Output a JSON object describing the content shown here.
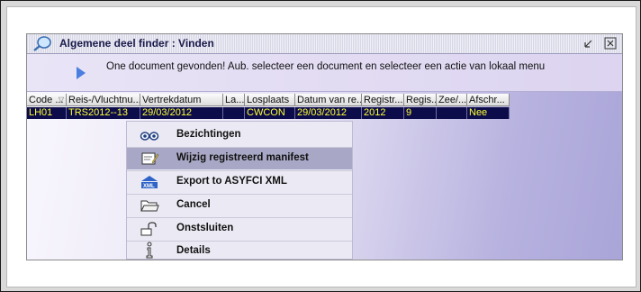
{
  "window": {
    "title": "Algemene deel finder : Vinden",
    "message": "One document gevonden! Aub. selecteer een document en selecteer een actie van lokaal menu"
  },
  "table": {
    "columns": [
      "Code ...",
      "Reis-/Vluchtnu...",
      "Vertrekdatum",
      "La...",
      "Losplaats",
      "Datum van re...",
      "Registr...",
      "Regis...",
      "Zee/...",
      "Afschr..."
    ],
    "rows": [
      [
        "LH01",
        "TRS2012--13",
        "29/03/2012",
        "",
        "CWCON",
        "29/03/2012",
        "2012",
        "9",
        "",
        "Nee"
      ]
    ]
  },
  "menu": {
    "items": [
      {
        "label": "Bezichtingen",
        "icon": "eyes-icon"
      },
      {
        "label": "Wijzig registreerd manifest",
        "icon": "edit-document-icon"
      },
      {
        "label": "Export to ASYFCI XML",
        "icon": "xml-export-icon"
      },
      {
        "label": "Cancel",
        "icon": "folder-icon"
      },
      {
        "label": "Onstsluiten",
        "icon": "unlock-icon"
      },
      {
        "label": "Details",
        "icon": "info-icon"
      }
    ],
    "highlighted_index": 1
  },
  "colors": {
    "selected_row_bg": "#0c0c4a",
    "selected_row_text": "#ffff33",
    "menu_highlight": "#a8a8c6"
  }
}
